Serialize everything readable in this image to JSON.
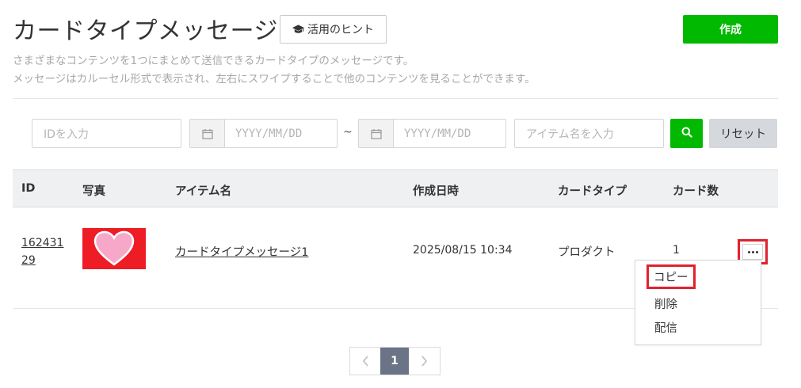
{
  "header": {
    "title": "カードタイプメッセージ",
    "hint_label": "活用のヒント",
    "create_label": "作成",
    "description_line1": "さまざまなコンテンツを1つにまとめて送信できるカードタイプのメッセージです。",
    "description_line2": "メッセージはカルーセル形式で表示され、左右にスワイプすることで他のコンテンツを見ることができます。"
  },
  "filters": {
    "id_placeholder": "IDを入力",
    "date_from_placeholder": "YYYY/MM/DD",
    "date_separator": "~",
    "date_to_placeholder": "YYYY/MM/DD",
    "item_name_placeholder": "アイテム名を入力",
    "reset_label": "リセット"
  },
  "table": {
    "columns": [
      "ID",
      "写真",
      "アイテム名",
      "作成日時",
      "カードタイプ",
      "カード数"
    ],
    "rows": [
      {
        "id": "16243129",
        "item_name": "カードタイプメッセージ1",
        "created_at": "2025/08/15 10:34",
        "card_type": "プロダクト",
        "card_count": "1"
      }
    ]
  },
  "row_menu": {
    "items": [
      "コピー",
      "削除",
      "配信"
    ]
  },
  "pagination": {
    "current_page": "1"
  },
  "colors": {
    "accent_green": "#00b900",
    "highlight_red": "#e0222f",
    "thumbnail_bg": "#ee1c25",
    "heart_fill": "#f7a8c9",
    "pager_active": "#6b7387"
  },
  "icons": {
    "hint": "graduation-cap-icon",
    "calendar": "calendar-icon",
    "search": "search-icon",
    "more": "more-dots-icon",
    "prev": "chevron-left-icon",
    "next": "chevron-right-icon",
    "thumbnail": "heart-image"
  }
}
